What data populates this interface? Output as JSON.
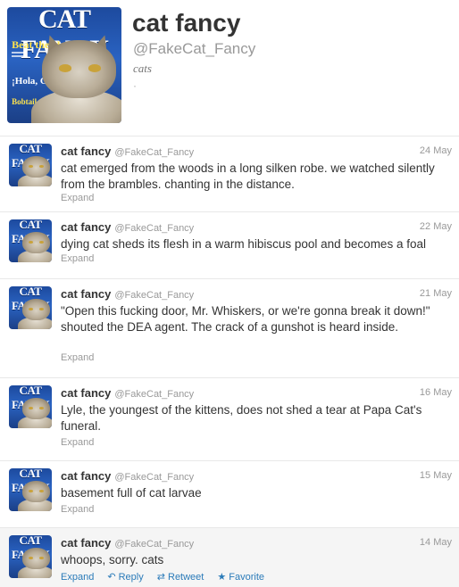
{
  "profile": {
    "name": "cat fancy",
    "handle": "@FakeCat_Fancy",
    "bio": "cats",
    "extra": "·",
    "cover": {
      "masthead": "CAT FANCY",
      "blurb1": "Beat the Heat",
      "blurb2": "¡Hola, Gato!",
      "blurb3": "Bobtail"
    }
  },
  "colors": {
    "link": "#2b7bb9",
    "muted": "#999999",
    "text": "#333333"
  },
  "tweets": [
    {
      "name": "cat fancy",
      "handle": "@FakeCat_Fancy",
      "date": "24 May",
      "text": "cat emerged from the woods in a long silken robe. we watched silently from the brambles. chanting in the distance.",
      "expand": "Expand"
    },
    {
      "name": "cat fancy",
      "handle": "@FakeCat_Fancy",
      "date": "22 May",
      "text": "dying cat sheds its flesh in a warm hibiscus pool and becomes a foal",
      "expand": "Expand"
    },
    {
      "name": "cat fancy",
      "handle": "@FakeCat_Fancy",
      "date": "21 May",
      "text": "\"Open this fucking door, Mr. Whiskers, or we're gonna break it down!\" shouted the DEA agent. The crack of a gunshot is heard inside.",
      "expand": "Expand"
    },
    {
      "name": "cat fancy",
      "handle": "@FakeCat_Fancy",
      "date": "16 May",
      "text": "Lyle, the youngest of the kittens, does not shed a tear at Papa Cat's funeral.",
      "expand": "Expand"
    },
    {
      "name": "cat fancy",
      "handle": "@FakeCat_Fancy",
      "date": "15 May",
      "text": "basement full of cat larvae",
      "expand": "Expand"
    },
    {
      "name": "cat fancy",
      "handle": "@FakeCat_Fancy",
      "date": "14 May",
      "text": "whoops, sorry. cats",
      "expand": "Expand",
      "reply": "Reply",
      "retweet": "Retweet",
      "favorite": "Favorite",
      "reply_icon": "reply-arrow-icon",
      "retweet_icon": "retweet-arrows-icon",
      "favorite_icon": "star-icon"
    }
  ]
}
